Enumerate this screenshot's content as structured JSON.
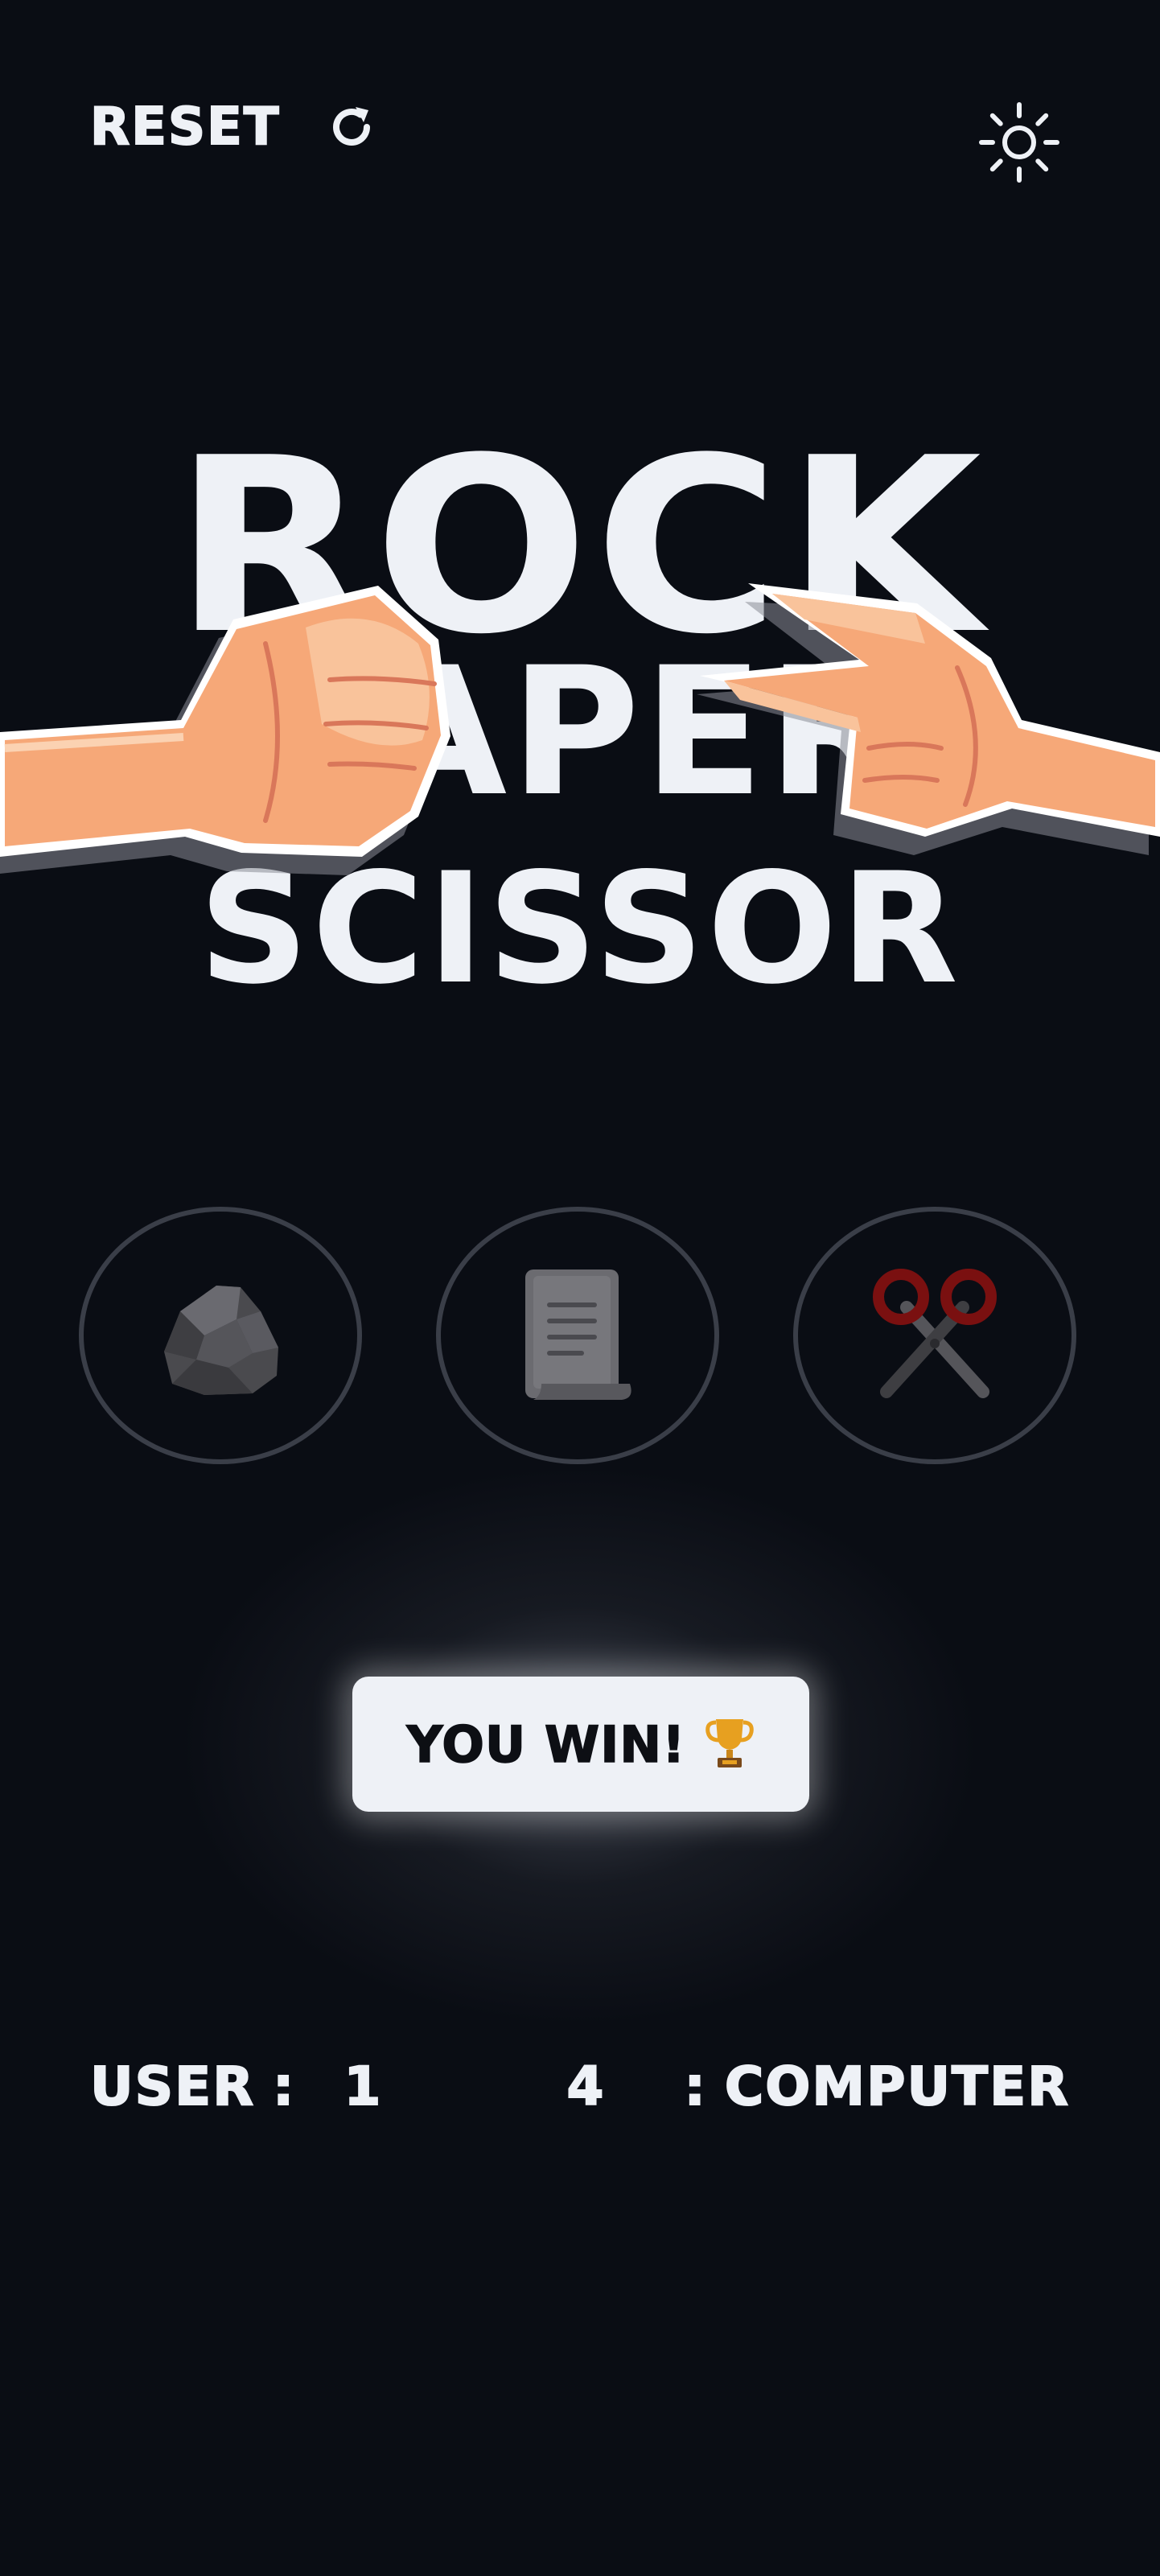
{
  "header": {
    "reset_label": "RESET",
    "reset_icon": "refresh-icon",
    "theme_icon": "sun-icon"
  },
  "title": {
    "line1": "ROCK",
    "line2": "PAPER",
    "line3": "SCISSOR"
  },
  "choices": [
    {
      "name": "rock",
      "icon": "rock-icon"
    },
    {
      "name": "paper",
      "icon": "paper-icon"
    },
    {
      "name": "scissors",
      "icon": "scissors-icon"
    }
  ],
  "result": {
    "text": "YOU WIN!",
    "emoji": "🏆"
  },
  "scores": {
    "user_label": "USER",
    "user_score": "1",
    "computer_label": "COMPUTER",
    "computer_score": "4",
    "separator": ":"
  },
  "colors": {
    "background": "#0a0d14",
    "text": "#eef1f6",
    "choice_border": "#3a3e48",
    "scissors_handle": "#7a1010",
    "hand_skin": "#f6a878"
  }
}
